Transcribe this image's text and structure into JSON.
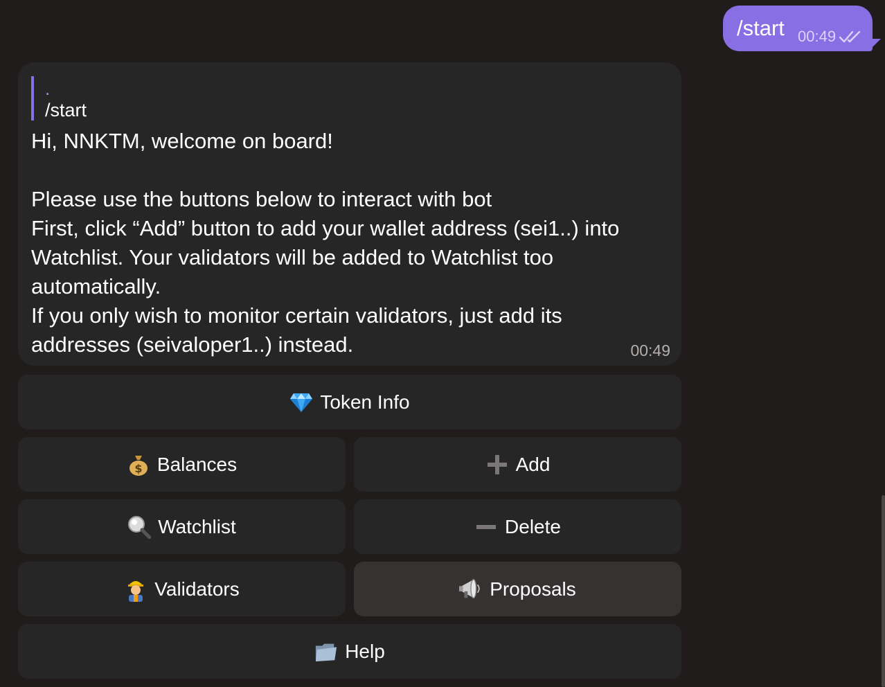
{
  "outgoing": {
    "text": "/start",
    "time": "00:49",
    "status_icon": "double-check-icon"
  },
  "incoming": {
    "reply": {
      "sender": ".",
      "text": "/start"
    },
    "lines": [
      "Hi, NNKTM, welcome on board!",
      "",
      "Please use the buttons below to interact with bot",
      "First, click “Add” button to add your wallet address (sei1..) into",
      "Watchlist. Your validators will be added to Watchlist too",
      "automatically.",
      "If you only wish to monitor certain validators, just add its",
      "addresses (seivaloper1..) instead."
    ],
    "time": "00:49"
  },
  "keyboard": {
    "token_info": {
      "label": "Token Info",
      "icon": "gem-icon"
    },
    "balances": {
      "label": "Balances",
      "icon": "money-bag-icon"
    },
    "add": {
      "label": "Add",
      "icon": "plus-icon"
    },
    "watchlist": {
      "label": "Watchlist",
      "icon": "magnifier-icon"
    },
    "delete": {
      "label": "Delete",
      "icon": "minus-icon"
    },
    "validators": {
      "label": "Validators",
      "icon": "construction-worker-icon"
    },
    "proposals": {
      "label": "Proposals",
      "icon": "megaphone-icon"
    },
    "help": {
      "label": "Help",
      "icon": "folder-icon"
    }
  },
  "colors": {
    "background": "#1f1c1b",
    "outgoing_bubble": "#8a6ee3",
    "incoming_bubble": "#272626",
    "button": "#272626",
    "button_active": "#353231",
    "accent": "#8a6ee3"
  }
}
